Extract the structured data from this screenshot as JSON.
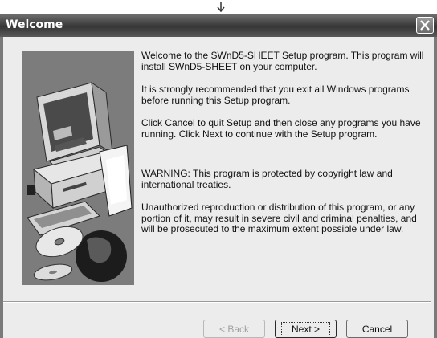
{
  "window": {
    "title": "Welcome"
  },
  "message": {
    "paragraphs": [
      "Welcome to the SWnD5-SHEET Setup program.  This program will install SWnD5-SHEET on your computer.",
      "It is strongly recommended that you exit all Windows programs before running this Setup program.",
      "Click Cancel to quit Setup and then close any programs you have running.  Click Next to continue with the Setup program.",
      "WARNING: This program is protected by copyright law and international treaties.",
      "Unauthorized reproduction or distribution of this program, or any portion of it, may result in severe civil and criminal penalties, and will be prosecuted to the maximum extent possible under law."
    ]
  },
  "buttons": {
    "back_label": "< Back",
    "next_label": "Next >",
    "cancel_label": "Cancel"
  },
  "icons": {
    "close": "close-icon",
    "cursor": "cursor-icon",
    "artwork": "computer-with-discs-illustration"
  },
  "colors": {
    "title_bar": "#3f3f3f",
    "dialog_background": "#ececec",
    "artwork_background": "#7c7c7c"
  }
}
